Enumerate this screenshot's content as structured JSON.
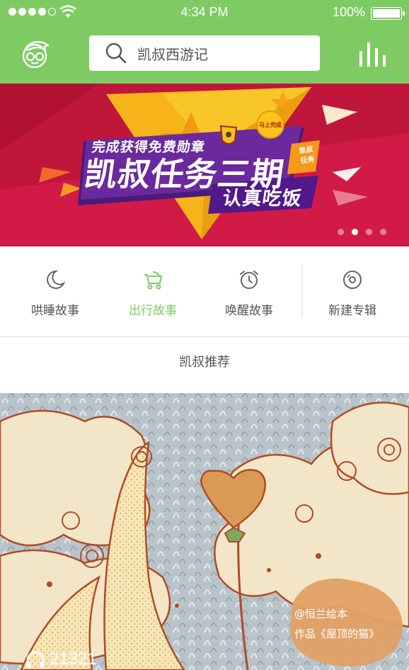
{
  "status": {
    "time": "4:34 PM",
    "battery": "100%",
    "battery_level": 1.0
  },
  "header": {
    "search_text": "凯叔西游记",
    "avatar_icon": "kid-face-icon",
    "stats_icon": "bar-chart-icon",
    "color": "#7ecb64"
  },
  "banner": {
    "line1": "完成获得免费勋章",
    "line2": "凯叔任务三期",
    "line3": "认真吃饭",
    "badge": "马上完成",
    "tag": "凯叔任务",
    "slide_count": 4,
    "active_slide": 2
  },
  "quicknav": [
    {
      "label": "哄睡故事",
      "icon": "moon-icon"
    },
    {
      "label": "出行故事",
      "icon": "stroller-icon",
      "active": true
    },
    {
      "label": "唤醒故事",
      "icon": "alarm-clock-icon"
    },
    {
      "label": "新建专辑",
      "icon": "disc-icon"
    }
  ],
  "section": {
    "title": "凯叔推荐"
  },
  "feature": {
    "credit_line1": "@恒兰绘本",
    "credit_line2": "作品《屋顶的猫》",
    "plays": "21321",
    "play_icon": "headphones-icon"
  }
}
